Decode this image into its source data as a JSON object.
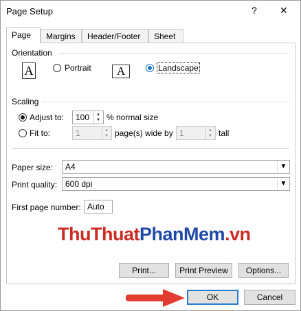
{
  "window": {
    "title": "Page Setup",
    "help": "?",
    "close": "✕"
  },
  "tabs": [
    {
      "label": "Page"
    },
    {
      "label": "Margins"
    },
    {
      "label": "Header/Footer"
    },
    {
      "label": "Sheet"
    }
  ],
  "orientation": {
    "label": "Orientation",
    "portrait_label": "Portrait",
    "landscape_label": "Landscape",
    "icon_glyph": "A",
    "selected": "landscape"
  },
  "scaling": {
    "label": "Scaling",
    "adjust_label": "Adjust to:",
    "adjust_value": "100",
    "adjust_unit": "% normal size",
    "fit_label": "Fit to:",
    "fit_wide_value": "1",
    "fit_wide_unit": "page(s) wide by",
    "fit_tall_value": "1",
    "fit_tall_unit": "tall"
  },
  "paper": {
    "size_label": "Paper size:",
    "size_value": "A4",
    "quality_label": "Print quality:",
    "quality_value": "600 dpi",
    "first_page_label": "First page number:",
    "first_page_value": "Auto"
  },
  "watermark": {
    "part1": "ThuThuat",
    "part2": "PhanMem",
    "part3": ".vn"
  },
  "buttons": {
    "print": "Print...",
    "preview": "Print Preview",
    "options": "Options...",
    "ok": "OK",
    "cancel": "Cancel"
  },
  "colors": {
    "accent": "#2b7bd1",
    "arrow": "#e23b2f",
    "watermark_red": "#cc2a22",
    "watermark_blue": "#1f4aa8"
  }
}
